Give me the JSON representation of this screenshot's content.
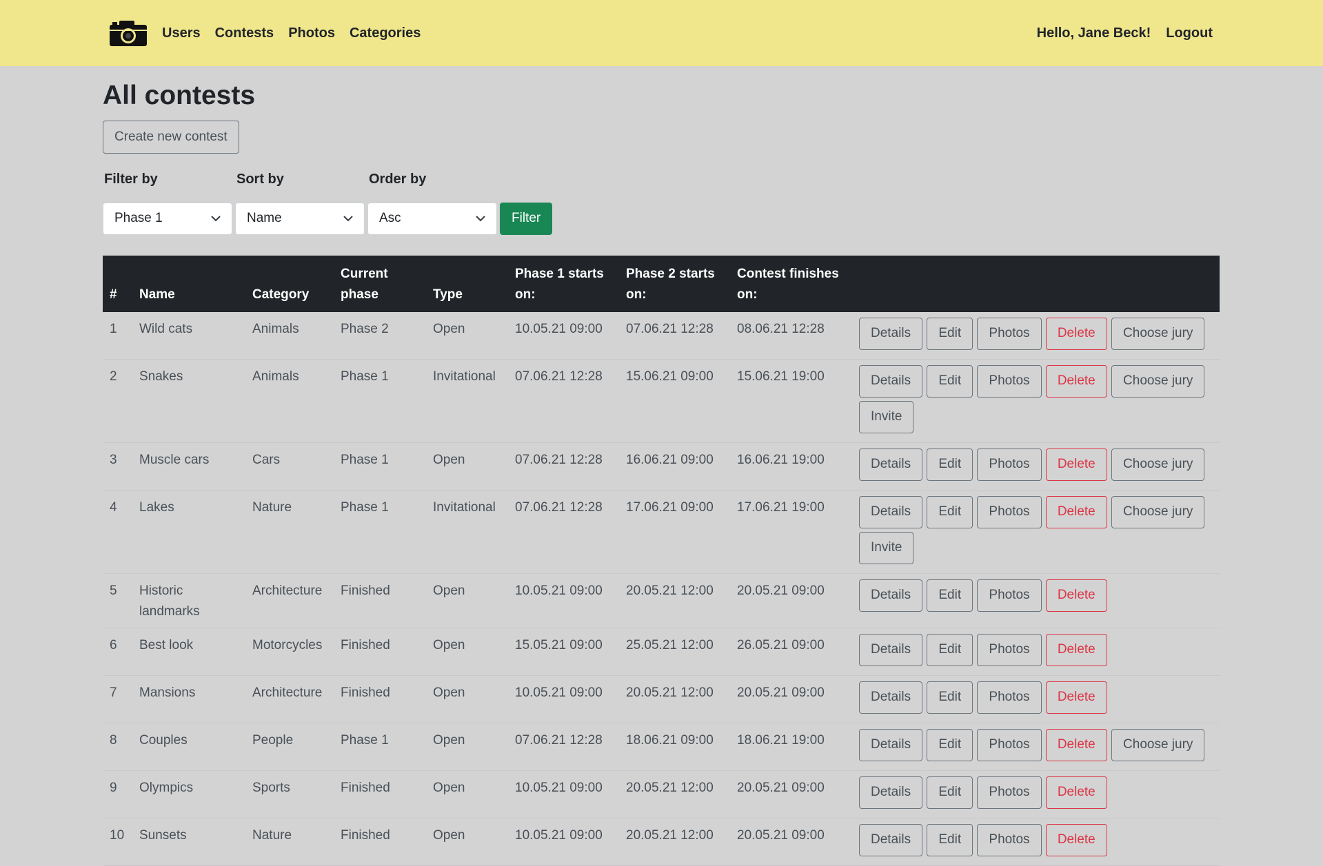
{
  "nav": {
    "links": [
      "Users",
      "Contests",
      "Photos",
      "Categories"
    ],
    "greeting": "Hello, Jane Beck!",
    "logout": "Logout",
    "logo_icon": "camera-icon"
  },
  "page": {
    "title": "All contests",
    "create_button": "Create new contest"
  },
  "filters": {
    "filter_label": "Filter by",
    "sort_label": "Sort by",
    "order_label": "Order by",
    "filter_value": "Phase 1",
    "sort_value": "Name",
    "order_value": "Asc",
    "filter_button": "Filter"
  },
  "table": {
    "headers": [
      "#",
      "Name",
      "Category",
      "Current phase",
      "Type",
      "Phase 1 starts on:",
      "Phase 2 starts on:",
      "Contest finishes on:"
    ],
    "action_labels": {
      "details": "Details",
      "edit": "Edit",
      "photos": "Photos",
      "delete": "Delete",
      "choose_jury": "Choose jury",
      "invite": "Invite"
    },
    "rows": [
      {
        "num": "1",
        "name": "Wild cats",
        "category": "Animals",
        "phase": "Phase 2",
        "type": "Open",
        "p1": "10.05.21 09:00",
        "p2": "07.06.21 12:28",
        "finish": "08.06.21 12:28",
        "jury": true,
        "invite": false
      },
      {
        "num": "2",
        "name": "Snakes",
        "category": "Animals",
        "phase": "Phase 1",
        "type": "Invitational",
        "p1": "07.06.21 12:28",
        "p2": "15.06.21 09:00",
        "finish": "15.06.21 19:00",
        "jury": true,
        "invite": true
      },
      {
        "num": "3",
        "name": "Muscle cars",
        "category": "Cars",
        "phase": "Phase 1",
        "type": "Open",
        "p1": "07.06.21 12:28",
        "p2": "16.06.21 09:00",
        "finish": "16.06.21 19:00",
        "jury": true,
        "invite": false
      },
      {
        "num": "4",
        "name": "Lakes",
        "category": "Nature",
        "phase": "Phase 1",
        "type": "Invitational",
        "p1": "07.06.21 12:28",
        "p2": "17.06.21 09:00",
        "finish": "17.06.21 19:00",
        "jury": true,
        "invite": true
      },
      {
        "num": "5",
        "name": "Historic landmarks",
        "category": "Architecture",
        "phase": "Finished",
        "type": "Open",
        "p1": "10.05.21 09:00",
        "p2": "20.05.21 12:00",
        "finish": "20.05.21 09:00",
        "jury": false,
        "invite": false
      },
      {
        "num": "6",
        "name": "Best look",
        "category": "Motorcycles",
        "phase": "Finished",
        "type": "Open",
        "p1": "15.05.21 09:00",
        "p2": "25.05.21 12:00",
        "finish": "26.05.21 09:00",
        "jury": false,
        "invite": false
      },
      {
        "num": "7",
        "name": "Mansions",
        "category": "Architecture",
        "phase": "Finished",
        "type": "Open",
        "p1": "10.05.21 09:00",
        "p2": "20.05.21 12:00",
        "finish": "20.05.21 09:00",
        "jury": false,
        "invite": false
      },
      {
        "num": "8",
        "name": "Couples",
        "category": "People",
        "phase": "Phase 1",
        "type": "Open",
        "p1": "07.06.21 12:28",
        "p2": "18.06.21 09:00",
        "finish": "18.06.21 19:00",
        "jury": true,
        "invite": false
      },
      {
        "num": "9",
        "name": "Olympics",
        "category": "Sports",
        "phase": "Finished",
        "type": "Open",
        "p1": "10.05.21 09:00",
        "p2": "20.05.21 12:00",
        "finish": "20.05.21 09:00",
        "jury": false,
        "invite": false
      },
      {
        "num": "10",
        "name": "Sunsets",
        "category": "Nature",
        "phase": "Finished",
        "type": "Open",
        "p1": "10.05.21 09:00",
        "p2": "20.05.21 12:00",
        "finish": "20.05.21 09:00",
        "jury": false,
        "invite": false
      }
    ]
  }
}
